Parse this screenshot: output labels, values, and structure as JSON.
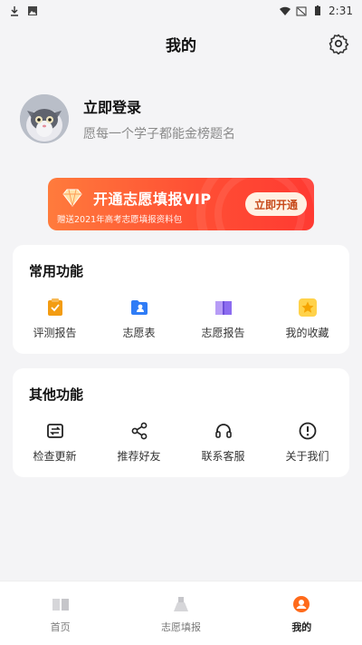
{
  "status_bar": {
    "time": "2:31",
    "icons_left": [
      "download-icon",
      "image-icon"
    ],
    "icons_right": [
      "wifi-icon",
      "signal-off-icon",
      "battery-icon"
    ]
  },
  "header": {
    "title": "我的",
    "settings_icon": "gear-icon"
  },
  "profile": {
    "login_label": "立即登录",
    "subtitle": "愿每一个学子都能金榜题名",
    "avatar_icon": "cat-avatar"
  },
  "vip_banner": {
    "title": "开通志愿填报VIP",
    "subtitle": "赠送2021年高考志愿填报资料包",
    "button_label": "立即开通",
    "icon": "diamond-icon"
  },
  "common_functions": {
    "title": "常用功能",
    "items": [
      {
        "label": "评测报告",
        "icon": "report-icon",
        "color": "#f39c12"
      },
      {
        "label": "志愿表",
        "icon": "folder-user-icon",
        "color": "#2f7cf6"
      },
      {
        "label": "志愿报告",
        "icon": "book-icon",
        "color": "#8c6cf0"
      },
      {
        "label": "我的收藏",
        "icon": "star-icon",
        "color": "#f5b400"
      }
    ]
  },
  "other_functions": {
    "title": "其他功能",
    "items": [
      {
        "label": "检查更新",
        "icon": "refresh-icon"
      },
      {
        "label": "推荐好友",
        "icon": "share-icon"
      },
      {
        "label": "联系客服",
        "icon": "headset-icon"
      },
      {
        "label": "关于我们",
        "icon": "info-icon"
      }
    ]
  },
  "tabbar": {
    "tabs": [
      {
        "label": "首页",
        "icon": "home-book-icon",
        "active": false
      },
      {
        "label": "志愿填报",
        "icon": "fill-icon",
        "active": false
      },
      {
        "label": "我的",
        "icon": "profile-icon",
        "active": true
      }
    ],
    "accent": "#ff6a1a"
  }
}
